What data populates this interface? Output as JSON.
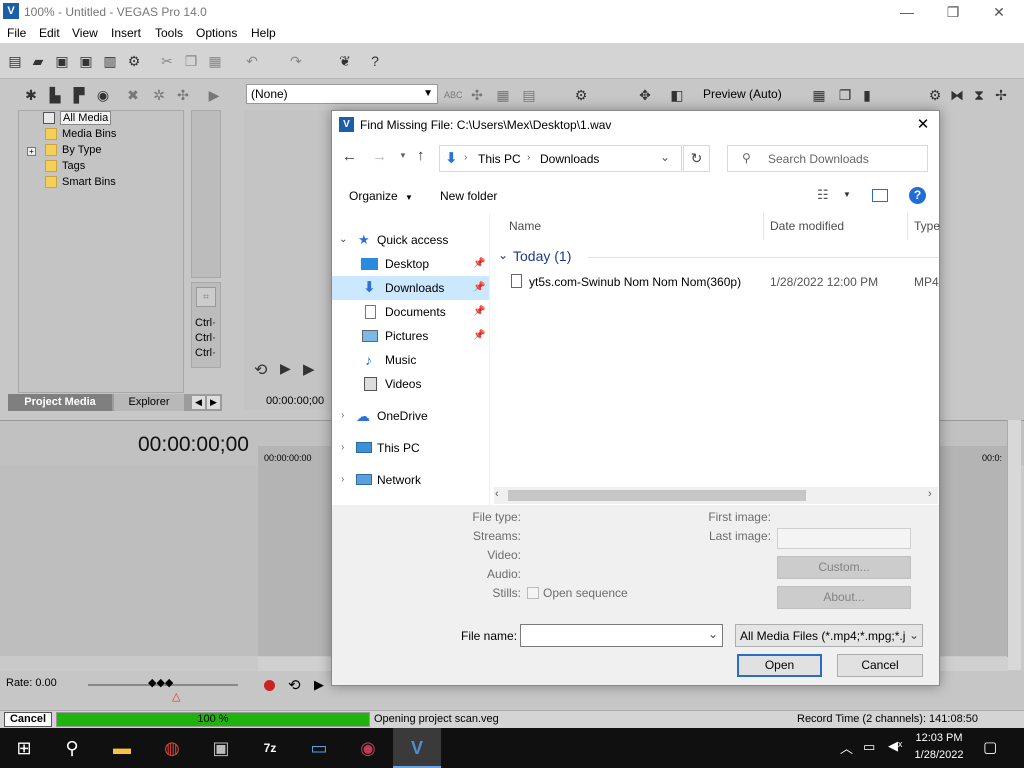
{
  "window": {
    "title": "100% - Untitled - VEGAS Pro 14.0",
    "minimize": "—",
    "maximize": "❐",
    "close": "✕"
  },
  "menu": [
    "File",
    "Edit",
    "View",
    "Insert",
    "Tools",
    "Options",
    "Help"
  ],
  "media_panel": {
    "tree": [
      "All Media",
      "Media Bins",
      "By Type",
      "Tags",
      "Smart Bins"
    ],
    "expand": "+",
    "tabs": [
      "Project Media",
      "Explorer"
    ],
    "side_labels": [
      "Ctrl·",
      "Ctrl·",
      "Ctrl·"
    ],
    "preview_select": "(None)",
    "preview_timecode": "00:00:00;00"
  },
  "preview_window": {
    "label": "Preview (Auto)"
  },
  "timeline": {
    "timecode": "00:00:00;00",
    "ruler_start": "00:00:00:00",
    "ruler_end": "00:0:",
    "rate": "Rate: 0.00"
  },
  "status": {
    "cancel": "Cancel",
    "progress_label": "100 %",
    "progress": 1.0,
    "message": "Opening project scan.veg",
    "record_time": "Record Time (2 channels): 141:08:50"
  },
  "dialog": {
    "title": "Find Missing File: C:\\Users\\Mex\\Desktop\\1.wav",
    "close": "✕",
    "breadcrumb": [
      "This PC",
      "Downloads"
    ],
    "search_placeholder": "Search Downloads",
    "organize": "Organize",
    "new_folder": "New folder",
    "help": "?",
    "nav": {
      "quick_access": "Quick access",
      "items": [
        "Desktop",
        "Downloads",
        "Documents",
        "Pictures",
        "Music",
        "Videos"
      ],
      "onedrive": "OneDrive",
      "this_pc": "This PC",
      "network": "Network"
    },
    "columns": [
      "Name",
      "Date modified",
      "Type"
    ],
    "group": "Today (1)",
    "files": [
      {
        "name": "yt5s.com-Swinub Nom Nom Nom(360p)",
        "date": "1/28/2022 12:00 PM",
        "type": "MP4"
      }
    ],
    "props_left": [
      "File type:",
      "Streams:",
      "Video:",
      "Audio:",
      "Stills:"
    ],
    "open_sequence": "Open sequence",
    "props_right": [
      "First image:",
      "Last image:"
    ],
    "custom": "Custom...",
    "about": "About...",
    "file_name_label": "File name:",
    "file_name_value": "",
    "filter": "All Media Files (*.mp4;*.mpg;*.j",
    "open": "Open",
    "cancel": "Cancel"
  },
  "taskbar": {
    "time": "12:03 PM",
    "date": "1/28/2022"
  }
}
